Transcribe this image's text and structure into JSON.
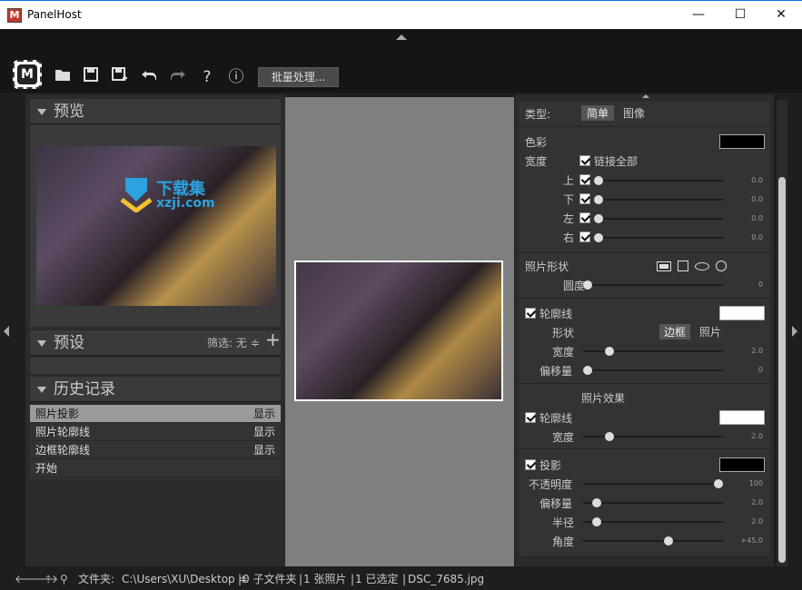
{
  "window": {
    "title": "PanelHost",
    "app_icon": "M",
    "minimize": "—",
    "maximize": "☐",
    "close": "✕"
  },
  "toolbar": {
    "logo": "M",
    "open_icon": "folder-icon",
    "save_icon": "save-icon",
    "saveas_icon": "save-as-icon",
    "undo_icon": "undo-icon",
    "redo_icon": "redo-icon",
    "help": "?",
    "info": "ⓘ",
    "batch_label": "批量处理..."
  },
  "left": {
    "preview_title": "预览",
    "watermark_cn": "下载集",
    "watermark_url": "xzji.com",
    "presets_title": "预设",
    "filter_label": "筛选:",
    "filter_value": "无",
    "add_symbol": "+",
    "history_title": "历史记录",
    "history": [
      {
        "name": "照片投影",
        "status": "显示",
        "selected": true
      },
      {
        "name": "照片轮廓线",
        "status": "显示",
        "selected": false
      },
      {
        "name": "边框轮廓线",
        "status": "显示",
        "selected": false
      },
      {
        "name": "开始",
        "status": "",
        "selected": false
      }
    ]
  },
  "right": {
    "type_label": "类型:",
    "type_simple": "简单",
    "type_image": "图像",
    "color_label": "色彩",
    "color_value": "#000000",
    "width_label": "宽度",
    "link_all": "链接全部",
    "sides": [
      {
        "label": "上",
        "value": "0.0",
        "level": 0
      },
      {
        "label": "下",
        "value": "0.0",
        "level": 0
      },
      {
        "label": "左",
        "value": "0.0",
        "level": 0
      },
      {
        "label": "右",
        "value": "0.0",
        "level": 0
      }
    ],
    "photo_shape_label": "照片形状",
    "roundness_label": "圆度",
    "roundness_value": "0",
    "outline_label": "轮廓线",
    "outline_color": "#ffffff",
    "shape_label": "形状",
    "shape_border": "边框",
    "shape_photo": "照片",
    "outline_width_label": "宽度",
    "outline_width_value": "2.0",
    "offset_label": "偏移量",
    "offset_value": "0",
    "effects_title": "照片效果",
    "effect_outline_label": "轮廓线",
    "effect_outline_color": "#ffffff",
    "effect_width_label": "宽度",
    "effect_width_value": "2.0",
    "shadow_label": "投影",
    "shadow_color": "#000000",
    "opacity_label": "不透明度",
    "opacity_value": "100",
    "shadow_offset_label": "偏移量",
    "shadow_offset_value": "2.0",
    "radius_label": "半径",
    "radius_value": "2.0",
    "angle_label": "角度",
    "angle_value": "+45.0"
  },
  "status": {
    "folder_label": "文件夹:",
    "path": "C:\\Users\\XU\\Desktop ≑",
    "subfolders": "0 子文件夹",
    "photos": "1 张照片",
    "selected": "1 已选定",
    "filename": "DSC_7685.jpg",
    "sep": "|"
  }
}
